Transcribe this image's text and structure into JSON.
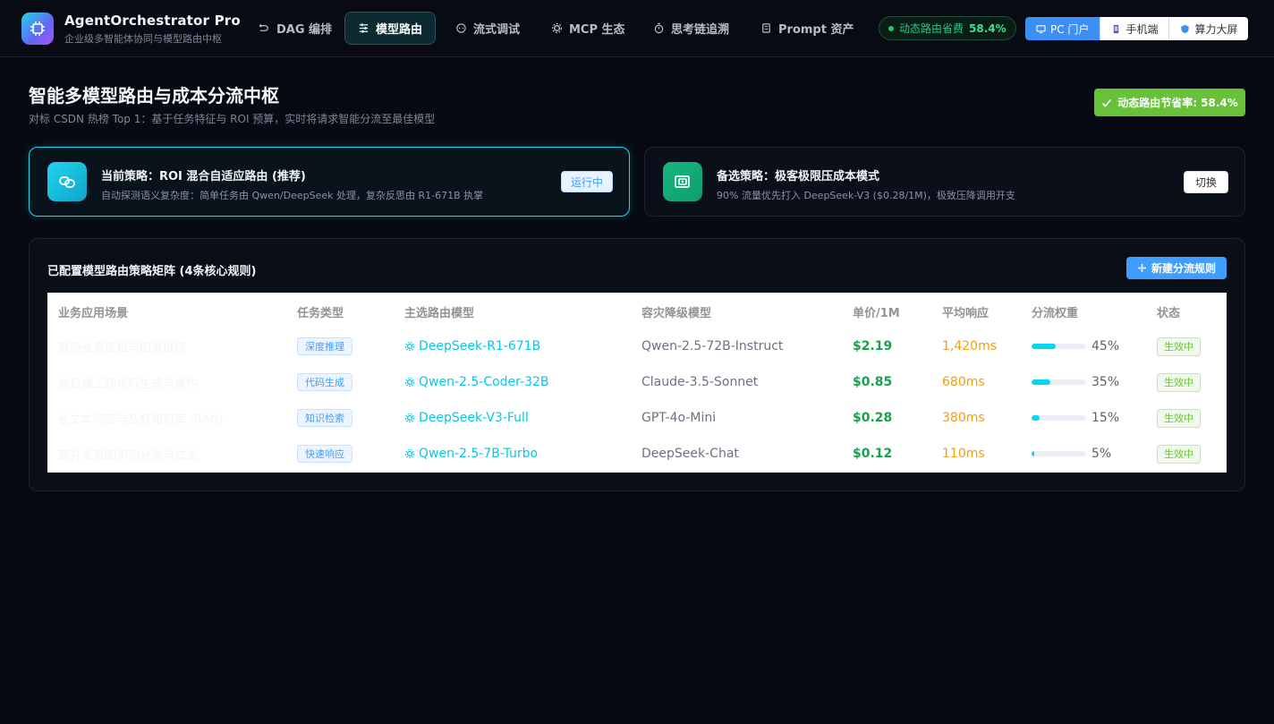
{
  "app": {
    "name": "AgentOrchestrator Pro",
    "subtitle": "企业级多智能体协同与模型路由中枢"
  },
  "nav": [
    {
      "label": "DAG 编排",
      "icon": "dag-icon",
      "active": false
    },
    {
      "label": "模型路由",
      "icon": "sliders-icon",
      "active": true
    },
    {
      "label": "流式调试",
      "icon": "chat-icon",
      "active": false
    },
    {
      "label": "MCP 生态",
      "icon": "gear-icon",
      "active": false
    },
    {
      "label": "思考链追溯",
      "icon": "timer-icon",
      "active": false
    },
    {
      "label": "Prompt 资产",
      "icon": "document-icon",
      "active": false
    }
  ],
  "saving_pill": {
    "label": "动态路由省费",
    "value": "58.4%"
  },
  "view_switch": [
    {
      "label": "PC 门户",
      "icon": "monitor-icon",
      "active": true
    },
    {
      "label": "手机端",
      "icon": "phone-icon",
      "active": false
    },
    {
      "label": "算力大屏",
      "icon": "shield-icon",
      "active": false
    }
  ],
  "page": {
    "title": "智能多模型路由与成本分流中枢",
    "subtitle": "对标 CSDN 热榜 Top 1：基于任务特征与 ROI 预算，实时将请求智能分流至最佳模型",
    "badge": "动态路由节省率: 58.4%"
  },
  "strategies": {
    "current": {
      "title": "当前策略：ROI 混合自适应路由 (推荐)",
      "desc": "自动探测语义复杂度：简单任务由 Qwen/DeepSeek 处理，复杂反思由 R1-671B 执掌",
      "tag": "运行中"
    },
    "alt": {
      "title": "备选策略：极客极限压成本模式",
      "desc": "90% 流量优先打入 DeepSeek-V3 ($0.28/1M)，极致压降调用开支",
      "button": "切换"
    }
  },
  "matrix": {
    "title": "已配置模型路由策略矩阵 (4条核心规则)",
    "new_button": "新建分流规则",
    "columns": [
      "业务应用场景",
      "任务类型",
      "主选路由模型",
      "容灾降级模型",
      "单价/1M",
      "平均响应",
      "分流权重",
      "状态"
    ],
    "rows": [
      {
        "scene": "复杂业务逻辑与因果推理",
        "type": "深度推理",
        "model": "DeepSeek-R1-671B",
        "fallback": "Qwen-2.5-72B-Instruct",
        "price": "$2.19",
        "latency": "1,420ms",
        "weight": 45,
        "weight_label": "45%",
        "status": "生效中"
      },
      {
        "scene": "前后端工程代码生成与重构",
        "type": "代码生成",
        "model": "Qwen-2.5-Coder-32B",
        "fallback": "Claude-3.5-Sonnet",
        "price": "$0.85",
        "latency": "680ms",
        "weight": 35,
        "weight_label": "35%",
        "status": "生效中"
      },
      {
        "scene": "长文本问答与私有知识库 (RAG)",
        "type": "知识检索",
        "model": "DeepSeek-V3-Full",
        "fallback": "GPT-4o-Mini",
        "price": "$0.28",
        "latency": "380ms",
        "weight": 15,
        "weight_label": "15%",
        "status": "生效中"
      },
      {
        "scene": "高并发意图识别分类与过滤",
        "type": "快速响应",
        "model": "Qwen-2.5-7B-Turbo",
        "fallback": "DeepSeek-Chat",
        "price": "$0.12",
        "latency": "110ms",
        "weight": 5,
        "weight_label": "5%",
        "status": "生效中"
      }
    ]
  }
}
